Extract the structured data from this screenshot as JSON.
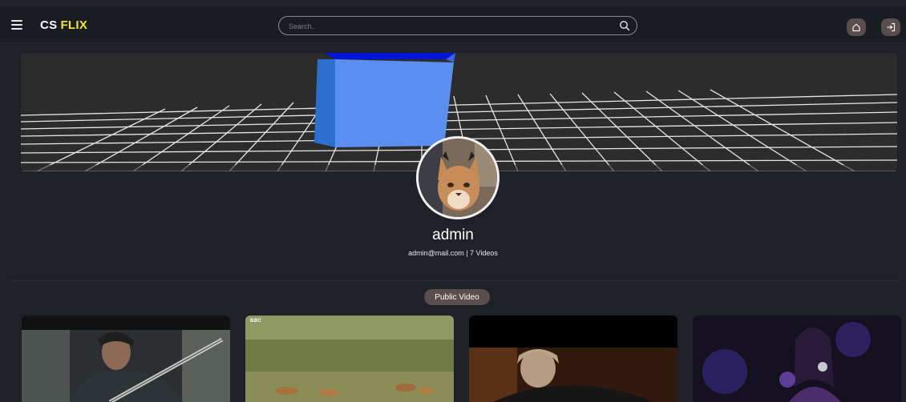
{
  "header": {
    "brand_part1": "CS",
    "brand_part2": "FLIX",
    "brand_accent_color": "#f5e52a",
    "search_placeholder": "Search.."
  },
  "profile": {
    "username": "admin",
    "meta": "admin@mail.com | 7 Videos",
    "banner_icon": "3d-cube-grid-banner",
    "avatar_icon": "caracal-avatar"
  },
  "section": {
    "public_video_label": "Public Video"
  },
  "videos": [
    {
      "thumbnail": "man-with-banjo"
    },
    {
      "thumbnail": "foxes-on-grassland",
      "badge": "BBC"
    },
    {
      "thumbnail": "person-video-still"
    },
    {
      "thumbnail": "singer-with-microphone"
    }
  ],
  "colors": {
    "background": "#1f2129",
    "topbar": "#1a1c23",
    "button": "#5a4d4d"
  }
}
